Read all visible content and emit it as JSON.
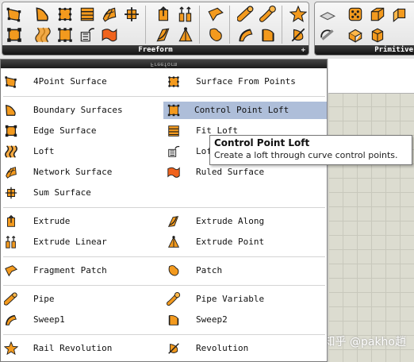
{
  "ribbon": {
    "freeform_panel": {
      "title": "Freeform",
      "pin_icon": "pin-icon"
    },
    "primitive_panel": {
      "title": "Primitive"
    },
    "freeform_tools": [
      "4point-surface-icon",
      "boundary-surfaces-icon",
      "surface-from-points-icon",
      "fit-loft-icon",
      "network-surface-icon",
      "sum-surface-icon",
      "extrude-icon",
      "extrude-linear-icon",
      "fragment-patch-icon",
      "pipe-icon",
      "pipe-variable-icon",
      "rail-revolution-icon",
      "edge-surface-icon",
      "loft-icon",
      "control-point-loft-icon",
      "loft-options-icon",
      "ruled-surface-icon",
      "extrude-along-icon",
      "extrude-point-icon",
      "patch-icon",
      "sweep1-icon",
      "sweep2-icon",
      "revolution-icon"
    ],
    "primitive_tools": [
      "plane-icon",
      "sphere-icon",
      "box-icon",
      "cylinder-icon",
      "center-box-icon",
      "box-2pt-icon"
    ]
  },
  "dropdown": {
    "header_label": "Freeform",
    "items": [
      {
        "label": "4Point Surface",
        "icon": "4point-surface-icon"
      },
      {
        "label": "Surface From Points",
        "icon": "surface-from-points-icon"
      },
      {
        "label": "Boundary Surfaces",
        "icon": "boundary-surfaces-icon"
      },
      {
        "label": "Control Point Loft",
        "icon": "control-point-loft-icon"
      },
      {
        "label": "Edge Surface",
        "icon": "edge-surface-icon"
      },
      {
        "label": "Fit Loft",
        "icon": "fit-loft-icon"
      },
      {
        "label": "Loft",
        "icon": "loft-icon"
      },
      {
        "label": "Lof",
        "icon": "loft-options-icon"
      },
      {
        "label": "Network Surface",
        "icon": "network-surface-icon"
      },
      {
        "label": "Ruled Surface",
        "icon": "ruled-surface-icon"
      },
      {
        "label": "Sum Surface",
        "icon": "sum-surface-icon"
      },
      {
        "label": "Extrude",
        "icon": "extrude-icon"
      },
      {
        "label": "Extrude Along",
        "icon": "extrude-along-icon"
      },
      {
        "label": "Extrude Linear",
        "icon": "extrude-linear-icon"
      },
      {
        "label": "Extrude Point",
        "icon": "extrude-point-icon"
      },
      {
        "label": "Fragment Patch",
        "icon": "fragment-patch-icon"
      },
      {
        "label": "Patch",
        "icon": "patch-icon"
      },
      {
        "label": "Pipe",
        "icon": "pipe-icon"
      },
      {
        "label": "Pipe Variable",
        "icon": "pipe-variable-icon"
      },
      {
        "label": "Sweep1",
        "icon": "sweep1-icon"
      },
      {
        "label": "Sweep2",
        "icon": "sweep2-icon"
      },
      {
        "label": "Rail Revolution",
        "icon": "rail-revolution-icon"
      },
      {
        "label": "Revolution",
        "icon": "revolution-icon"
      }
    ],
    "highlighted_item": "Control Point Loft"
  },
  "tooltip": {
    "title": "Control Point Loft",
    "description": "Create a loft through curve control points."
  },
  "watermark": "知乎 @pakho趙",
  "colors": {
    "icon_orange": "#f39a1e",
    "icon_dark": "#1d1d1d",
    "highlight": "#aebed9",
    "ribbon_footer": "#1e1e1e"
  }
}
